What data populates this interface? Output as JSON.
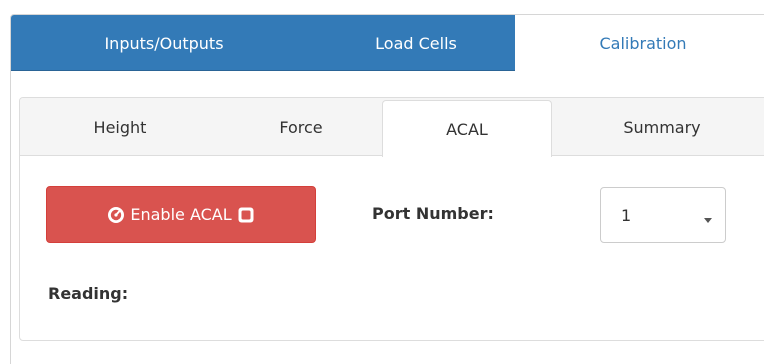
{
  "top_tabs": [
    {
      "label": "Inputs/Outputs"
    },
    {
      "label": "Load Cells"
    },
    {
      "label": "Calibration",
      "active": true
    }
  ],
  "sub_tabs": [
    {
      "label": "Height"
    },
    {
      "label": "Force"
    },
    {
      "label": "ACAL",
      "active": true
    },
    {
      "label": "Summary"
    }
  ],
  "acal": {
    "button_label": "Enable ACAL",
    "button_icon_left": "dashboard-icon",
    "button_icon_right": "stop-icon",
    "button_color": "#d9534f",
    "port_label": "Port Number:",
    "port_value": "1",
    "reading_label": "Reading:"
  },
  "colors": {
    "accent": "#337ab7",
    "danger": "#d9534f"
  }
}
